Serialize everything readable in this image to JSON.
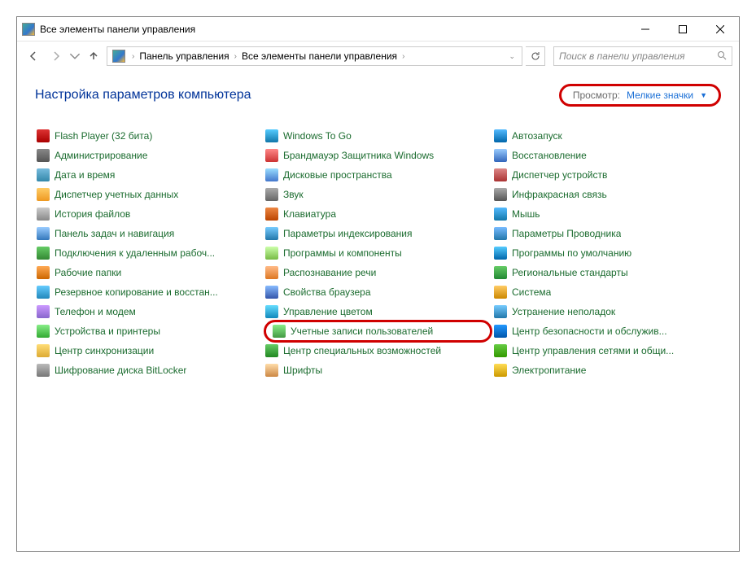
{
  "window_title": "Все элементы панели управления",
  "breadcrumb": {
    "items": [
      "Панель управления",
      "Все элементы панели управления"
    ]
  },
  "search": {
    "placeholder": "Поиск в панели управления"
  },
  "page_title": "Настройка параметров компьютера",
  "view": {
    "label": "Просмотр:",
    "value": "Мелкие значки"
  },
  "items": [
    {
      "label": "Flash Player (32 бита)",
      "name": "flash-player"
    },
    {
      "label": "Администрирование",
      "name": "administration"
    },
    {
      "label": "Дата и время",
      "name": "date-time"
    },
    {
      "label": "Диспетчер учетных данных",
      "name": "credential-manager"
    },
    {
      "label": "История файлов",
      "name": "file-history"
    },
    {
      "label": "Панель задач и навигация",
      "name": "taskbar-nav"
    },
    {
      "label": "Подключения к удаленным рабоч...",
      "name": "remote-desktop"
    },
    {
      "label": "Рабочие папки",
      "name": "work-folders"
    },
    {
      "label": "Резервное копирование и восстан...",
      "name": "backup-restore"
    },
    {
      "label": "Телефон и модем",
      "name": "phone-modem"
    },
    {
      "label": "Устройства и принтеры",
      "name": "devices-printers"
    },
    {
      "label": "Центр синхронизации",
      "name": "sync-center"
    },
    {
      "label": "Шифрование диска BitLocker",
      "name": "bitlocker"
    },
    {
      "label": "Windows To Go",
      "name": "windows-to-go"
    },
    {
      "label": "Брандмауэр Защитника Windows",
      "name": "defender-firewall"
    },
    {
      "label": "Дисковые пространства",
      "name": "storage-spaces"
    },
    {
      "label": "Звук",
      "name": "sound"
    },
    {
      "label": "Клавиатура",
      "name": "keyboard"
    },
    {
      "label": "Параметры индексирования",
      "name": "indexing-options"
    },
    {
      "label": "Программы и компоненты",
      "name": "programs-features"
    },
    {
      "label": "Распознавание речи",
      "name": "speech-recognition"
    },
    {
      "label": "Свойства браузера",
      "name": "internet-options"
    },
    {
      "label": "Управление цветом",
      "name": "color-management"
    },
    {
      "label": "Учетные записи пользователей",
      "name": "user-accounts",
      "highlight": true
    },
    {
      "label": "Центр специальных возможностей",
      "name": "ease-of-access"
    },
    {
      "label": "Шрифты",
      "name": "fonts"
    },
    {
      "label": "Автозапуск",
      "name": "autoplay"
    },
    {
      "label": "Восстановление",
      "name": "recovery"
    },
    {
      "label": "Диспетчер устройств",
      "name": "device-manager"
    },
    {
      "label": "Инфракрасная связь",
      "name": "infrared"
    },
    {
      "label": "Мышь",
      "name": "mouse"
    },
    {
      "label": "Параметры Проводника",
      "name": "explorer-options"
    },
    {
      "label": "Программы по умолчанию",
      "name": "default-programs"
    },
    {
      "label": "Региональные стандарты",
      "name": "region"
    },
    {
      "label": "Система",
      "name": "system"
    },
    {
      "label": "Устранение неполадок",
      "name": "troubleshooting"
    },
    {
      "label": "Центр безопасности и обслужив...",
      "name": "security-maintenance"
    },
    {
      "label": "Центр управления сетями и общи...",
      "name": "network-sharing"
    },
    {
      "label": "Электропитание",
      "name": "power-options"
    }
  ]
}
